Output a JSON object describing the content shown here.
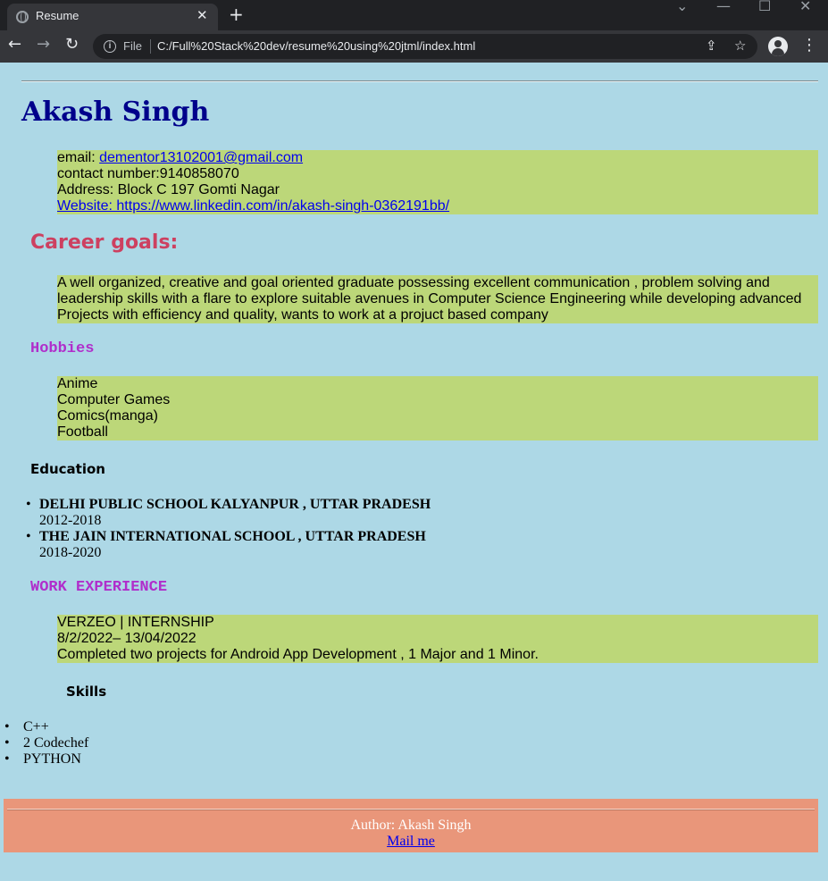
{
  "browser": {
    "tab_title": "Resume",
    "close_glyph": "✕",
    "new_tab_glyph": "+",
    "window_controls": [
      "⌄",
      "—",
      "☐",
      "✕"
    ],
    "nav": {
      "back": "←",
      "forward": "→",
      "reload": "↻"
    },
    "file_label": "File",
    "url": "C:/Full%20Stack%20dev/resume%20using%20jtml/index.html",
    "share_glyph": "⇪",
    "star_glyph": "☆",
    "menu_glyph": "⋮"
  },
  "resume": {
    "name": "Akash Singh",
    "contact": {
      "email_label": "email: ",
      "email": "dementor13102001@gmail.com",
      "phone": "contact number:9140858070",
      "address": "Address: Block C 197 Gomti Nagar",
      "website": "Website: https://www.linkedin.com/in/akash-singh-0362191bb/"
    },
    "career_heading": "Career goals:",
    "career_text": "A well organized, creative and goal oriented graduate possessing excellent communication , problem solving and leadership skills with a flare to explore suitable avenues in Computer Science Engineering while developing advanced Projects with efficiency and quality, wants to work at a projuct based company",
    "hobbies_heading": "Hobbies",
    "hobbies": [
      "Anime",
      "Computer Games",
      "Comics(manga)",
      "Football"
    ],
    "education_heading": "Education",
    "education": [
      {
        "school": "DELHI PUBLIC SCHOOL KALYANPUR , UTTAR PRADESH",
        "years": "2012-2018"
      },
      {
        "school": "THE JAIN INTERNATIONAL SCHOOL , UTTAR PRADESH",
        "years": "2018-2020"
      }
    ],
    "work_heading": "WORK EXPERIENCE",
    "work": {
      "title": "VERZEO | INTERNSHIP",
      "dates": "8/2/2022– 13/04/2022",
      "description": "Completed two projects for Android App Development , 1 Major and 1 Minor."
    },
    "skills_heading": "Skills",
    "skills": [
      "C++",
      "2 Codechef",
      "PYTHON"
    ],
    "footer": {
      "author": "Author: Akash Singh",
      "mail": "Mail me"
    }
  },
  "colors": {
    "page_background": "#add8e6",
    "highlight": "#bcd779",
    "name": "#00008b",
    "career_heading": "#cd4060",
    "mono_headings": "#b02ecb",
    "footer": "#e9967a"
  }
}
